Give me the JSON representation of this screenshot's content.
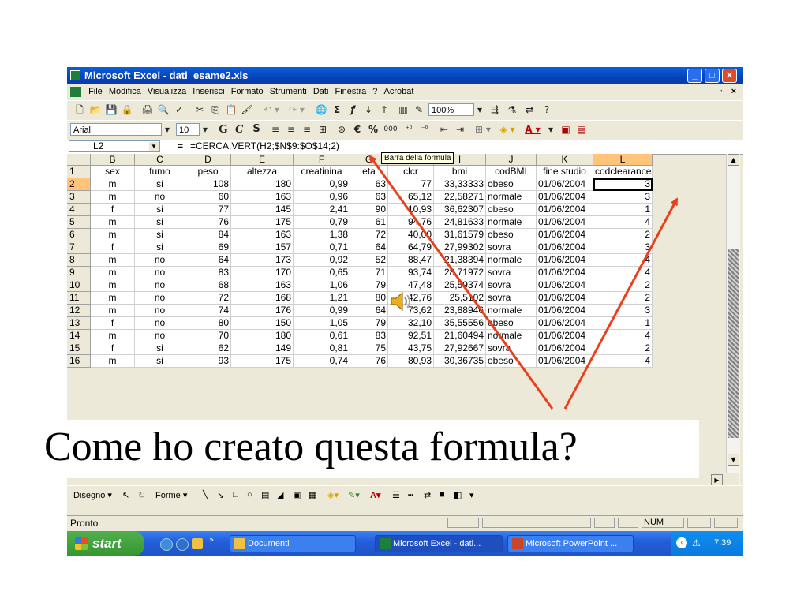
{
  "window": {
    "title": "Microsoft Excel - dati_esame2.xls",
    "controls": [
      "_",
      "□",
      "✕"
    ]
  },
  "menu": {
    "items": [
      "File",
      "Modifica",
      "Visualizza",
      "Inserisci",
      "Formato",
      "Strumenti",
      "Dati",
      "Finestra",
      "?",
      "Acrobat"
    ],
    "right_controls": "_ ▫ ×"
  },
  "toolbar": {
    "zoom": "100%",
    "font_name": "Arial",
    "font_size": "10",
    "bold": "G",
    "italic": "C",
    "underline": "S",
    "currency": "€",
    "percent": "%",
    "thousands": "000"
  },
  "formula_bar": {
    "cell_ref": "L2",
    "equals": "=",
    "formula": "=CERCA.VERT(H2;$N$9:$O$14;2)",
    "tooltip": "Barra della formula"
  },
  "sheet": {
    "columns": [
      "B",
      "C",
      "D",
      "E",
      "F",
      "G",
      "H",
      "I",
      "J",
      "K",
      "L"
    ],
    "selected_column": "L",
    "rows": [
      {
        "n": "1",
        "cells": [
          "sex",
          "fumo",
          "peso",
          "altezza",
          "creatinina",
          "eta",
          "clcr",
          "bmi",
          "codBMI",
          "fine studio",
          "codclearance"
        ]
      },
      {
        "n": "2",
        "cells": [
          "m",
          "si",
          "108",
          "180",
          "0,99",
          "63",
          "77",
          "33,33333",
          "obeso",
          "01/06/2004",
          "3"
        ]
      },
      {
        "n": "3",
        "cells": [
          "m",
          "no",
          "60",
          "163",
          "0,96",
          "63",
          "65,12",
          "22,58271",
          "normale",
          "01/06/2004",
          "3"
        ]
      },
      {
        "n": "4",
        "cells": [
          "f",
          "si",
          "77",
          "145",
          "2,41",
          "90",
          "10,93",
          "36,62307",
          "obeso",
          "01/06/2004",
          "1"
        ]
      },
      {
        "n": "5",
        "cells": [
          "m",
          "si",
          "76",
          "175",
          "0,79",
          "61",
          "94,76",
          "24,81633",
          "normale",
          "01/06/2004",
          "4"
        ]
      },
      {
        "n": "6",
        "cells": [
          "m",
          "si",
          "84",
          "163",
          "1,38",
          "72",
          "40,00",
          "31,61579",
          "obeso",
          "01/06/2004",
          "2"
        ]
      },
      {
        "n": "7",
        "cells": [
          "f",
          "si",
          "69",
          "157",
          "0,71",
          "64",
          "64,79",
          "27,99302",
          "sovra",
          "01/06/2004",
          "3"
        ]
      },
      {
        "n": "8",
        "cells": [
          "m",
          "no",
          "64",
          "173",
          "0,92",
          "52",
          "88,47",
          "21,38394",
          "normale",
          "01/06/2004",
          "4"
        ]
      },
      {
        "n": "9",
        "cells": [
          "m",
          "no",
          "83",
          "170",
          "0,65",
          "71",
          "93,74",
          "28,71972",
          "sovra",
          "01/06/2004",
          "4"
        ]
      },
      {
        "n": "10",
        "cells": [
          "m",
          "no",
          "68",
          "163",
          "1,06",
          "79",
          "47,48",
          "25,59374",
          "sovra",
          "01/06/2004",
          "2"
        ]
      },
      {
        "n": "11",
        "cells": [
          "m",
          "no",
          "72",
          "168",
          "1,21",
          "80",
          "42,76",
          "25,5102",
          "sovra",
          "01/06/2004",
          "2"
        ]
      },
      {
        "n": "12",
        "cells": [
          "m",
          "no",
          "74",
          "176",
          "0,99",
          "64",
          "73,62",
          "23,88946",
          "normale",
          "01/06/2004",
          "3"
        ]
      },
      {
        "n": "13",
        "cells": [
          "f",
          "no",
          "80",
          "150",
          "1,05",
          "79",
          "32,10",
          "35,55556",
          "obeso",
          "01/06/2004",
          "1"
        ]
      },
      {
        "n": "14",
        "cells": [
          "m",
          "no",
          "70",
          "180",
          "0,61",
          "83",
          "92,51",
          "21,60494",
          "normale",
          "01/06/2004",
          "4"
        ]
      },
      {
        "n": "15",
        "cells": [
          "f",
          "si",
          "62",
          "149",
          "0,81",
          "75",
          "43,75",
          "27,92667",
          "sovra",
          "01/06/2004",
          "2"
        ]
      },
      {
        "n": "16",
        "cells": [
          "m",
          "si",
          "93",
          "175",
          "0,74",
          "76",
          "80,93",
          "30,36735",
          "obeso",
          "01/06/2004",
          "4"
        ]
      }
    ]
  },
  "drawing_bar": {
    "draw": "Disegno ▾",
    "shapes": "Forme ▾"
  },
  "status": {
    "text": "Pronto",
    "num": "NUM"
  },
  "taskbar": {
    "start": "start",
    "buttons": [
      "Documenti",
      "Microsoft Excel - dati...",
      "Microsoft PowerPoint ..."
    ],
    "clock": "7.39"
  },
  "caption": "Come ho creato questa formula?",
  "colors": {
    "title_blue": "#0842b8",
    "arrow_red": "#e8401c",
    "selection_orange": "#ffc37a"
  }
}
